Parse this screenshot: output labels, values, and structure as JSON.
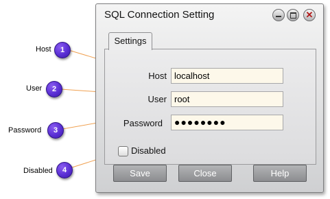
{
  "window": {
    "title": "SQL Connection Setting",
    "controls": {
      "minimize": "minimize-icon",
      "maximize": "maximize-icon",
      "close": "close-icon",
      "close_glyph": "✕"
    }
  },
  "tab": {
    "label": "Settings"
  },
  "form": {
    "host_label": "Host",
    "host_value": "localhost",
    "user_label": "User",
    "user_value": "root",
    "password_label": "Password",
    "password_value": "●●●●●●●●",
    "disabled_label": "Disabled",
    "disabled_checked": false
  },
  "buttons": {
    "save": "Save",
    "close": "Close",
    "help": "Help"
  },
  "annotations": [
    {
      "num": "1",
      "label": "Host"
    },
    {
      "num": "2",
      "label": "User"
    },
    {
      "num": "3",
      "label": "Password"
    },
    {
      "num": "4",
      "label": "Disabled"
    }
  ],
  "colors": {
    "badge": "#5a2fd4",
    "leader_line": "#f0a050",
    "field_bg": "#fdf8ea"
  }
}
